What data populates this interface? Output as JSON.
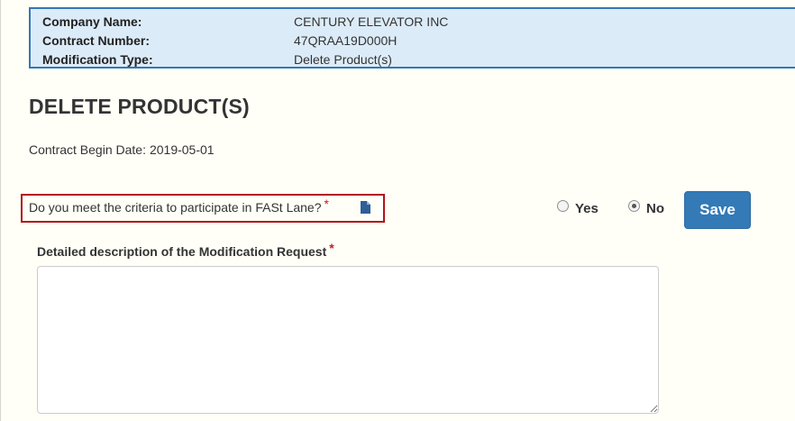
{
  "contract_info": {
    "rows": [
      {
        "label": "Company Name:",
        "value": "CENTURY ELEVATOR INC"
      },
      {
        "label": "Contract Number:",
        "value": "47QRAA19D000H"
      },
      {
        "label": "Modification Type:",
        "value": "Delete Product(s)"
      }
    ]
  },
  "page": {
    "title": "DELETE PRODUCT(S)",
    "begin_date_label": "Contract Begin Date:",
    "begin_date_value": "2019-05-01"
  },
  "fastlane": {
    "question": "Do you meet the criteria to participate in FASt Lane?",
    "required_marker": "*",
    "icon": "document-icon",
    "options": [
      {
        "label": "Yes",
        "selected": false
      },
      {
        "label": "No",
        "selected": true
      }
    ]
  },
  "actions": {
    "save_label": "Save"
  },
  "description": {
    "label": "Detailed description of the Modification Request",
    "required_marker": "*",
    "value": ""
  },
  "colors": {
    "info_background": "#dcebf8",
    "info_border": "#3477b6",
    "highlight_border": "#b2121a",
    "save_button": "#337ab7",
    "required": "#c0201f",
    "page_background": "#fffff8"
  }
}
